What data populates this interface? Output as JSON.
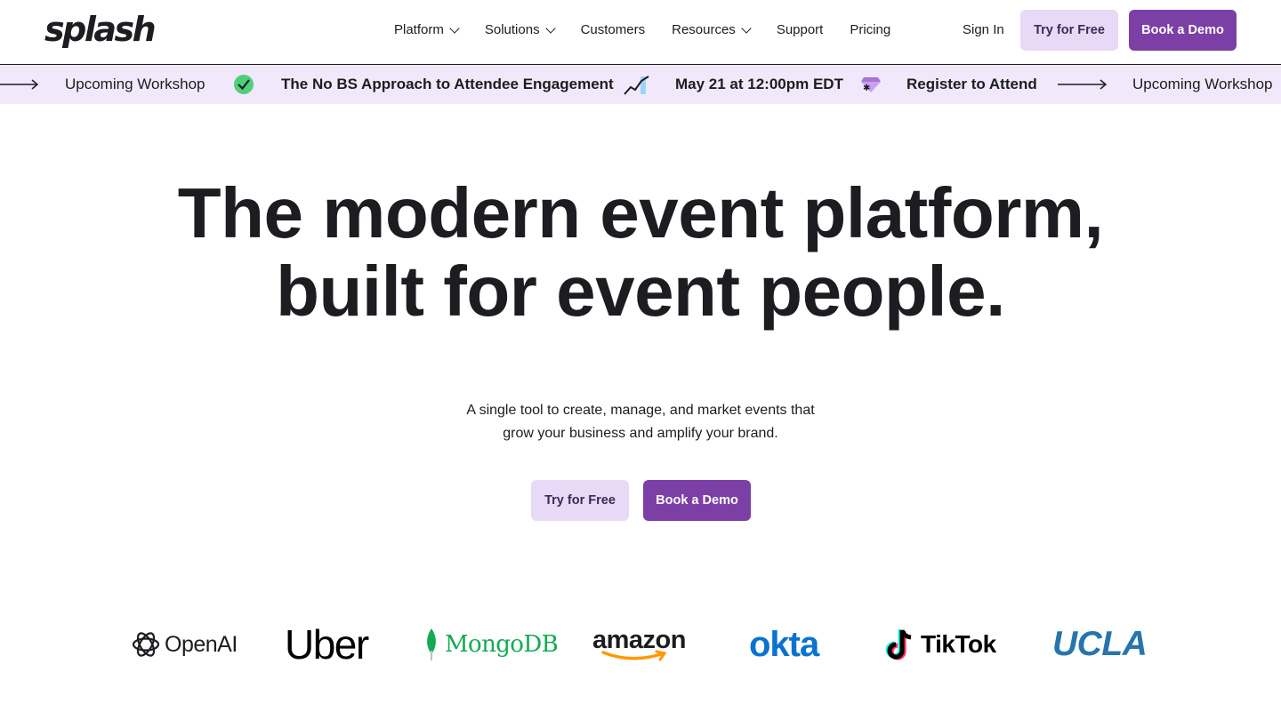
{
  "brand": {
    "logo_text": "splash"
  },
  "nav": {
    "items": [
      {
        "label": "Platform",
        "has_dropdown": true
      },
      {
        "label": "Solutions",
        "has_dropdown": true
      },
      {
        "label": "Customers",
        "has_dropdown": false
      },
      {
        "label": "Resources",
        "has_dropdown": true
      },
      {
        "label": "Support",
        "has_dropdown": false
      },
      {
        "label": "Pricing",
        "has_dropdown": false
      }
    ],
    "sign_in": "Sign In",
    "try_free": "Try for Free",
    "book_demo": "Book a Demo"
  },
  "ticker": {
    "items": [
      "Upcoming Workshop",
      "The No BS Approach to Attendee Engagement",
      "May 21 at 12:00pm EDT",
      "Register to Attend",
      "Upcoming Workshop"
    ],
    "icons": [
      "arrow-right-icon",
      "check-circle-icon",
      "chart-line-icon",
      "gem-icon",
      "arrow-right-icon"
    ]
  },
  "hero": {
    "title_line1": "The modern event platform,",
    "title_line2": "built for event people.",
    "subtitle_line1": "A single tool to create, manage, and market events that",
    "subtitle_line2": "grow your business and amplify your brand.",
    "try_free": "Try for Free",
    "book_demo": "Book a Demo"
  },
  "customers": {
    "logos": [
      "OpenAI",
      "Uber",
      "MongoDB",
      "amazon",
      "okta",
      "TikTok",
      "UCLA"
    ]
  },
  "colors": {
    "accent": "#7b3fa6",
    "accent_light": "#e8d9f7",
    "ticker_bg": "#f1e9fb",
    "text": "#1c1d21",
    "mongodb_green": "#13aa52",
    "okta_blue": "#0b73cf",
    "ucla_blue": "#2774ae",
    "amazon_orange": "#ff9900"
  }
}
